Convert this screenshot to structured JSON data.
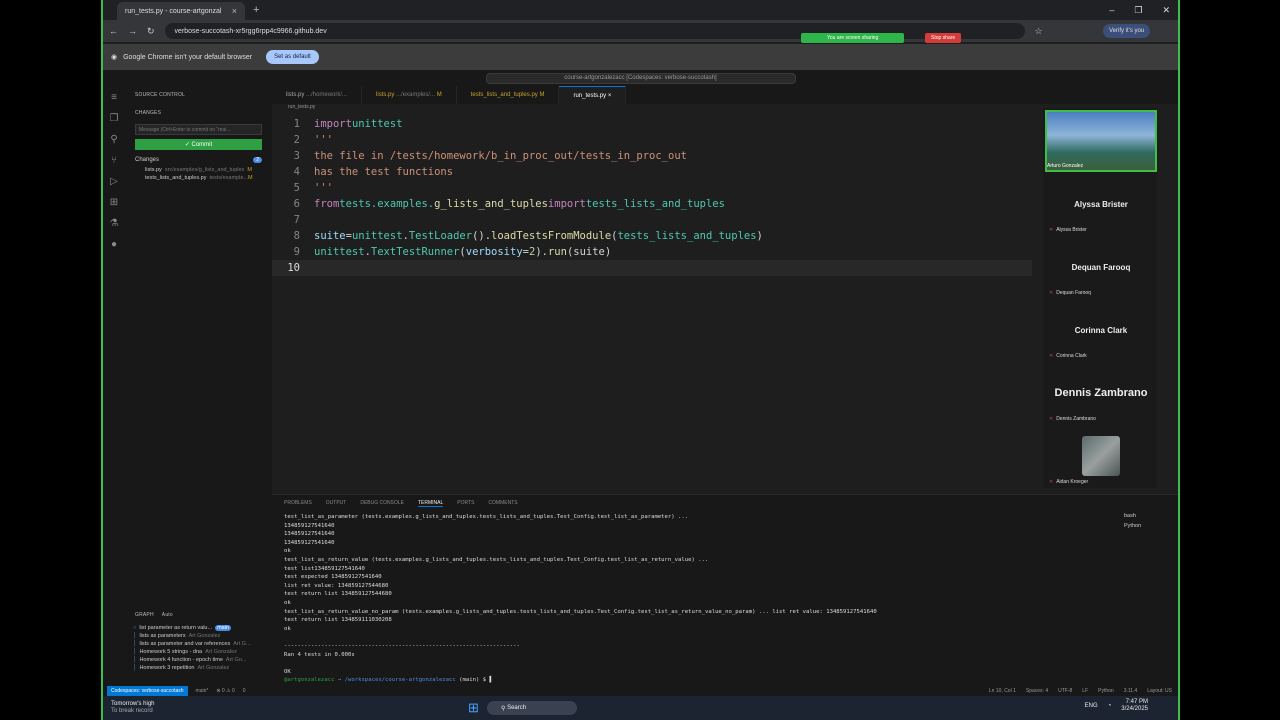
{
  "browser": {
    "tab_title": "run_tests.py - course-artgonzal",
    "url": "verbose-succotash-xr5rgg6rpp4c9966.github.dev",
    "share_text": "You are screen sharing",
    "stop_share": "Stop share",
    "verify": "Verify it's you",
    "infobar_text": "Google Chrome isn't your default browser",
    "set_default": "Set as default"
  },
  "vscode": {
    "command_center": "course-artgonzalezacc [Codespaces: verbose-succotash]",
    "sidebar": {
      "title": "SOURCE CONTROL",
      "changes_header": "CHANGES",
      "message_placeholder": "Message (Ctrl+Enter to commit on \"mai...",
      "commit_label": "✓ Commit",
      "changes_group": "Changes",
      "changes_count": "2",
      "files": [
        {
          "name": "lists.py",
          "path": "src/examples/g_lists_and_tuples",
          "status": "M"
        },
        {
          "name": "tests_lists_and_tuples.py",
          "path": "tests/example...",
          "status": "M"
        }
      ],
      "graph_title": "GRAPH",
      "graph_auto": "Auto",
      "graph": [
        {
          "msg": "list parameter as return valu...",
          "author": "main"
        },
        {
          "msg": "lists as parameters",
          "author": "Art Gonzalez"
        },
        {
          "msg": "lists as parameter and var references",
          "author": "Art G..."
        },
        {
          "msg": "Homework 5 strings - dna",
          "author": "Art Gonzalez"
        },
        {
          "msg": "Homework 4 function - epoch time",
          "author": "Art Go..."
        },
        {
          "msg": "Homework 3 repetition",
          "author": "Art Gonzalez"
        }
      ]
    },
    "tabs": [
      {
        "name": "lists.py",
        "path": ".../homework/...",
        "mod": ""
      },
      {
        "name": "lists.py",
        "path": ".../examples/...",
        "mod": "M"
      },
      {
        "name": "tests_lists_and_tuples.py",
        "path": "",
        "mod": "M"
      },
      {
        "name": "run_tests.py",
        "path": "",
        "mod": "×"
      }
    ],
    "breadcrumb": "run_tests.py",
    "code": {
      "l1a": "import",
      "l1b": " unittest",
      "l2": "'''",
      "l3": "the file in /tests/homework/b_in_proc_out/tests_in_proc_out",
      "l4": "has the test functions",
      "l5": "'''",
      "l6a": "from",
      "l6b": " tests.examples.",
      "l6c": "g_lists_and_tuples",
      "l6d": " import",
      "l6e": " tests_lists_and_tuples",
      "l8a": "suite",
      "l8b": " = ",
      "l8c": "unittest",
      "l8d": ".",
      "l8e": "TestLoader",
      "l8f": "().",
      "l8g": "loadTestsFromModule",
      "l8h": "(",
      "l8i": "tests_lists_and_tuples",
      "l8j": ")",
      "l9a": "unittest",
      "l9b": ".",
      "l9c": "TextTestRunner",
      "l9d": "(",
      "l9e": "verbosity",
      "l9f": "=",
      "l9g": "2",
      "l9h": ").",
      "l9i": "run",
      "l9j": "(suite)"
    },
    "panel_tabs": [
      "PROBLEMS",
      "OUTPUT",
      "DEBUG CONSOLE",
      "TERMINAL",
      "PORTS",
      "COMMENTS"
    ],
    "terminal_lines": [
      "test_list_as_parameter (tests.examples.g_lists_and_tuples.tests_lists_and_tuples.Test_Config.test_list_as_parameter) ...",
      "134859127541640",
      "134859127541640",
      "134859127541640",
      "ok",
      "test_list_as_return_value (tests.examples.g_lists_and_tuples.tests_lists_and_tuples.Test_Config.test_list_as_return_value) ...",
      "test list134859127541640",
      "test expected 134859127541640",
      "list ret value: 134859127544680",
      "test return list 134859127544680",
      "ok",
      "test_list_as_return_value_no_param (tests.examples.g_lists_and_tuples.tests_lists_and_tuples.Test_Config.test_list_as_return_value_no_param) ... list ret value: 134859127541640",
      "test return list 134859111030208",
      "ok",
      "",
      "----------------------------------------------------------------------",
      "Ran 4 tests in 0.000s",
      "",
      "OK"
    ],
    "prompt_user": "@artgonzalezacc",
    "prompt_path": "→ /workspaces/course-artgonzalezacc",
    "prompt_branch": "(main) $",
    "terminal_list": [
      "bash",
      "Python"
    ],
    "status": {
      "remote": "Codespaces: verbose-succotash",
      "branch": "main*",
      "problems": "⊗ 0 ⚠ 0",
      "ports": "0",
      "position": "Ln 10, Col 1",
      "spaces": "Spaces: 4",
      "encoding": "UTF-8",
      "eol": "LF",
      "language": "Python",
      "version": "3.11.4",
      "layout": "Layout: US"
    }
  },
  "participants": {
    "video_name": "Arturo Gonzalez",
    "people": [
      {
        "big": "Alyssa Brister",
        "small": "Alyssa Brister"
      },
      {
        "big": "Dequan Farooq",
        "small": "Dequan Farooq"
      },
      {
        "big": "Corinna Clark",
        "small": "Corinna Clark"
      },
      {
        "big": "Dennis Zambrano",
        "small": "Dennis Zambrano"
      }
    ],
    "last": "Aidan Kroeger"
  },
  "taskbar": {
    "weather_line1": "Tomorrow's high",
    "weather_line2": "To break record",
    "search": "Search",
    "lang": "ENG",
    "time": "7:47 PM",
    "date": "3/24/2025"
  }
}
